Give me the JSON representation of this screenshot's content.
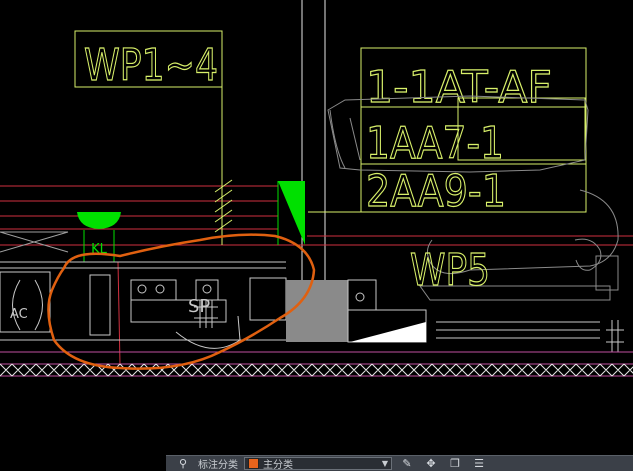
{
  "drawing": {
    "tags": {
      "wp1": "WP1~4",
      "row1": "1-1AT-AF",
      "row2": "1AA7-1",
      "row3": "2AA9-1",
      "wp5": "WP5",
      "kl": "KL",
      "ac": "AC",
      "sp": "SP"
    },
    "colors": {
      "background": "#000000",
      "text": "#d8f06a",
      "red_line": "#d03040",
      "magenta_line": "#c050a0",
      "green_symbol": "#00e000",
      "markup_cloud": "#e06010",
      "white_line": "#e6e6e6",
      "gray_fill": "#8a8a8a"
    }
  },
  "statusbar": {
    "layer_label": "标注分类",
    "current_layer": "主分类",
    "layer_color": "#e8641c",
    "icons": [
      "layer-match-icon",
      "edit-pencil-icon",
      "move-icon",
      "copy-icon",
      "layer-stack-icon"
    ]
  }
}
